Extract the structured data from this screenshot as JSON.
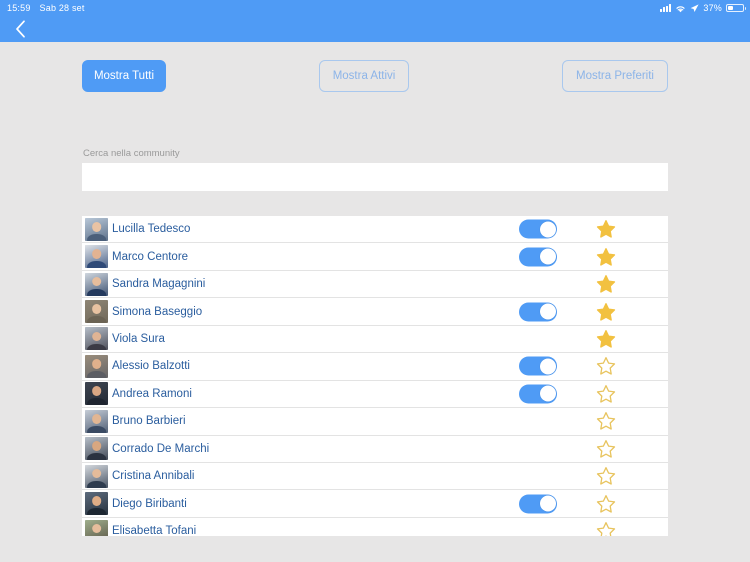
{
  "statusbar": {
    "time": "15:59",
    "date": "Sab 28 set",
    "battery_percent": "37%",
    "signal_icon": "signal-bars-icon",
    "wifi_icon": "wifi-icon",
    "location_icon": "location-arrow-icon",
    "battery_icon": "battery-icon",
    "bar_color": "#4f9bf5"
  },
  "navbar": {
    "back_icon": "chevron-left-icon",
    "bar_color": "#4f9bf5"
  },
  "filters": [
    {
      "label": "Mostra Tutti",
      "style": "primary",
      "selected": true
    },
    {
      "label": "Mostra Attivi",
      "style": "ghost",
      "selected": false
    },
    {
      "label": "Mostra Preferiti",
      "style": "ghost",
      "selected": false
    }
  ],
  "search": {
    "label": "Cerca nella community",
    "value": "",
    "placeholder": ""
  },
  "theme": {
    "accent": "#4f9bf5",
    "accent_outline": "#a9c8ee",
    "accent_outline_text": "#8cb4e8",
    "name_text": "#2a5d9e",
    "page_background": "#e7e6e6",
    "row_background": "#ffffff",
    "row_divider": "#e3e3e3",
    "star_filled": "#f2c140",
    "star_empty_stroke": "#e8c45e"
  },
  "list": {
    "rows": [
      {
        "name": "Lucilla Tedesco",
        "toggle": true,
        "toggle_on": true,
        "favorite": true,
        "avatar": {
          "bg": "#b9c8d8",
          "skin": "#e9c3a4",
          "shirt": "#4b5f7a"
        }
      },
      {
        "name": "Marco Centore",
        "toggle": true,
        "toggle_on": true,
        "favorite": true,
        "avatar": {
          "bg": "#dfe3e8",
          "skin": "#e3b392",
          "shirt": "#2f4a78"
        }
      },
      {
        "name": "Sandra Magagnini",
        "toggle": false,
        "toggle_on": false,
        "favorite": true,
        "avatar": {
          "bg": "#cfd6de",
          "skin": "#e7bd9c",
          "shirt": "#243a5e"
        }
      },
      {
        "name": "Simona Baseggio",
        "toggle": true,
        "toggle_on": true,
        "favorite": true,
        "avatar": {
          "bg": "#8e8575",
          "skin": "#e8c2a1",
          "shirt": "#6b6354"
        }
      },
      {
        "name": "Viola Sura",
        "toggle": false,
        "toggle_on": false,
        "favorite": true,
        "avatar": {
          "bg": "#b6bec9",
          "skin": "#e0b494",
          "shirt": "#3b3b45"
        }
      },
      {
        "name": "Alessio Balzotti",
        "toggle": true,
        "toggle_on": true,
        "favorite": false,
        "avatar": {
          "bg": "#9a8d7c",
          "skin": "#e0b08c",
          "shirt": "#5c5d63"
        }
      },
      {
        "name": "Andrea Ramoni",
        "toggle": true,
        "toggle_on": true,
        "favorite": false,
        "avatar": {
          "bg": "#3d4450",
          "skin": "#d9a683",
          "shirt": "#1f2530"
        }
      },
      {
        "name": "Bruno Barbieri",
        "toggle": false,
        "toggle_on": false,
        "favorite": false,
        "avatar": {
          "bg": "#c5ccd6",
          "skin": "#e2b693",
          "shirt": "#3a4a63"
        }
      },
      {
        "name": "Corrado De Marchi",
        "toggle": false,
        "toggle_on": false,
        "favorite": false,
        "avatar": {
          "bg": "#b7bfc9",
          "skin": "#d8a780",
          "shirt": "#2b3240"
        }
      },
      {
        "name": "Cristina Annibali",
        "toggle": false,
        "toggle_on": false,
        "favorite": false,
        "avatar": {
          "bg": "#d4d8dd",
          "skin": "#e4bb9a",
          "shirt": "#2e3b4e"
        }
      },
      {
        "name": "Diego Biribanti",
        "toggle": true,
        "toggle_on": true,
        "favorite": false,
        "avatar": {
          "bg": "#5d6b7d",
          "skin": "#e0ad86",
          "shirt": "#1d2732"
        }
      },
      {
        "name": "Elisabetta Tofani",
        "toggle": false,
        "toggle_on": false,
        "favorite": false,
        "avatar": {
          "bg": "#9fae8c",
          "skin": "#e6bd9c",
          "shirt": "#4d4438"
        }
      }
    ]
  }
}
